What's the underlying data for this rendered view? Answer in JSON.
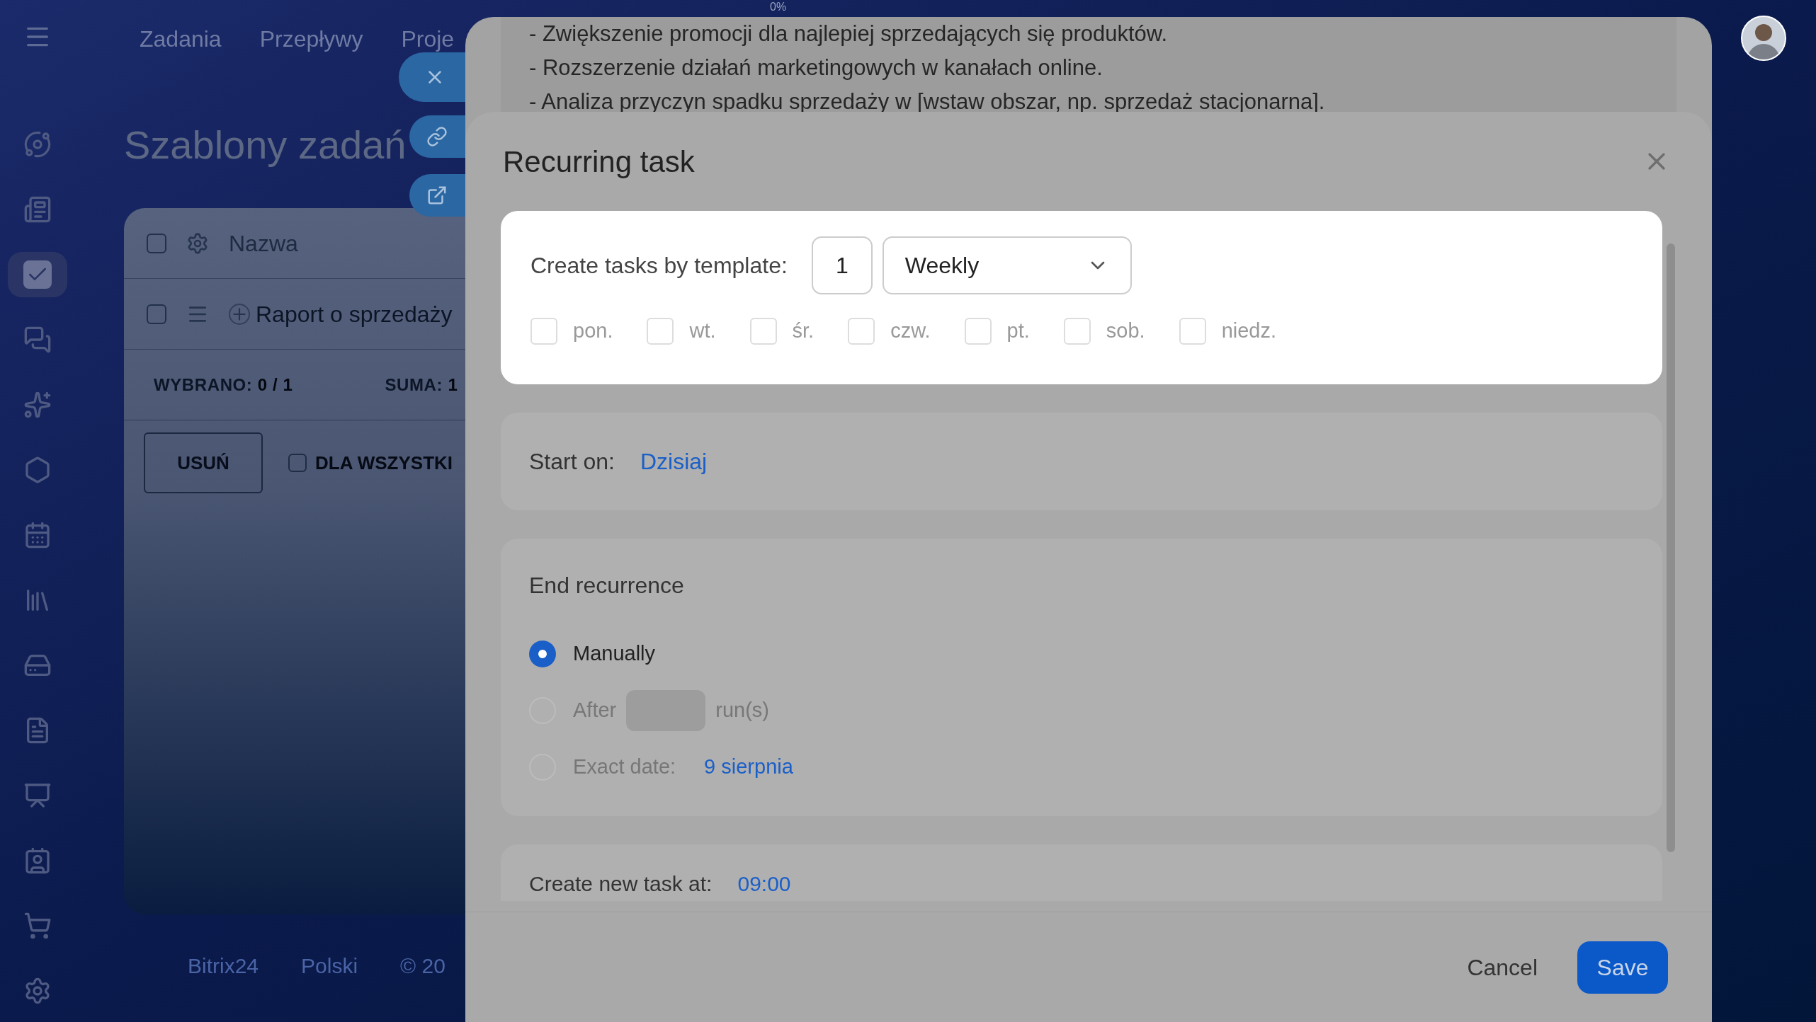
{
  "nav": {
    "tabs": [
      {
        "label": "Zadania"
      },
      {
        "label": "Przepływy"
      },
      {
        "label": "Proje"
      }
    ]
  },
  "sidebar": {
    "items": [
      {
        "selected": false
      },
      {
        "selected": false
      },
      {
        "selected": true
      },
      {
        "selected": false
      },
      {
        "selected": false
      },
      {
        "selected": false
      },
      {
        "selected": false
      },
      {
        "selected": false
      },
      {
        "selected": false
      },
      {
        "selected": false
      },
      {
        "selected": false
      },
      {
        "selected": false
      },
      {
        "selected": false
      },
      {
        "selected": false
      }
    ]
  },
  "page": {
    "title": "Szablony zadań",
    "table": {
      "header": {
        "checked": false,
        "label": "Nazwa"
      },
      "rows": [
        {
          "checked": false,
          "name": "Raport o sprzedaży"
        }
      ],
      "summary": [
        {
          "label": "WYBRANO:",
          "value": "0 / 1"
        },
        {
          "label": "SUMA:",
          "value": "1"
        }
      ],
      "delete_button": "USUŃ",
      "for_all": {
        "checked": false,
        "label": "DLA WSZYSTKI"
      }
    }
  },
  "footer": {
    "brand": "Bitrix24",
    "language": "Polski",
    "copyright": "© 20"
  },
  "task_panel": {
    "progress": "0%",
    "lines": [
      "- Zwiększenie promocji dla najlepiej sprzedających się produktów.",
      "- Rozszerzenie działań marketingowych w kanałach online.",
      "- Analiza przyczyn spadku sprzedaży w [wstaw obszar, np. sprzedaż stacjonarna]."
    ]
  },
  "dialog": {
    "title": "Recurring task",
    "template": {
      "label": "Create tasks by template:",
      "count": "1",
      "period": "Weekly",
      "days": [
        {
          "label": "pon.",
          "checked": false
        },
        {
          "label": "wt.",
          "checked": false
        },
        {
          "label": "śr.",
          "checked": false
        },
        {
          "label": "czw.",
          "checked": false
        },
        {
          "label": "pt.",
          "checked": false
        },
        {
          "label": "sob.",
          "checked": false
        },
        {
          "label": "niedz.",
          "checked": false
        }
      ]
    },
    "start": {
      "label": "Start on:",
      "value": "Dzisiaj"
    },
    "end": {
      "heading": "End recurrence",
      "options": [
        {
          "kind": "plain",
          "label": "Manually",
          "selected": true
        },
        {
          "kind": "count",
          "label": "After",
          "suffix": "run(s)",
          "selected": false
        },
        {
          "kind": "date",
          "label": "Exact date:",
          "value": "9 sierpnia",
          "selected": false
        }
      ]
    },
    "time": {
      "label": "Create new task at:",
      "value": "09:00"
    },
    "buttons": {
      "cancel": "Cancel",
      "save": "Save"
    }
  }
}
